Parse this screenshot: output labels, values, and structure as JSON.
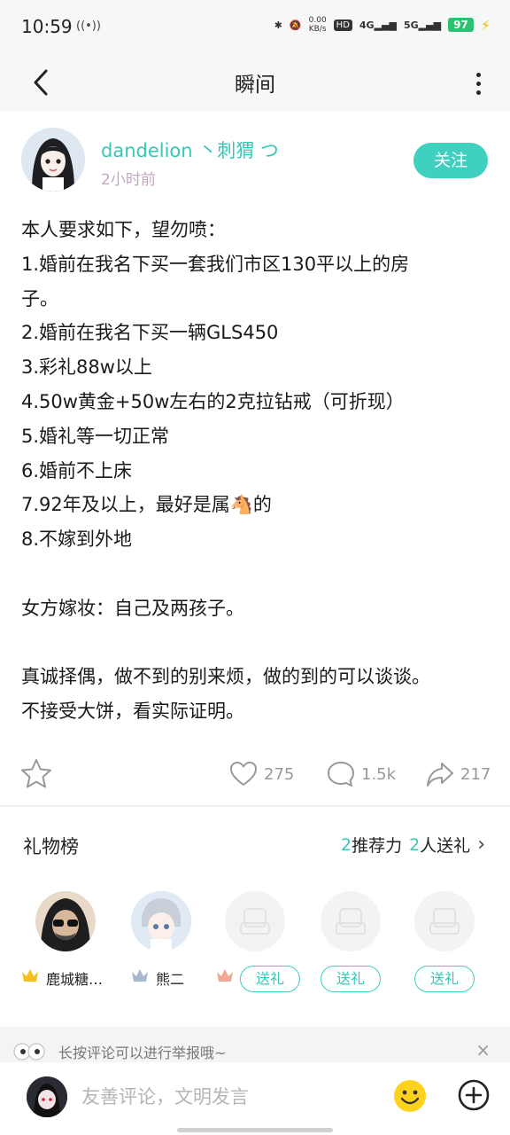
{
  "status_bar": {
    "time": "10:59",
    "hotspot": "((•))",
    "speed_value": "0.00",
    "speed_unit": "KB/s",
    "hd": "HD",
    "signal_1": "4G",
    "signal_2": "5G",
    "battery": "97",
    "icons": [
      "bluetooth-icon",
      "mute-icon",
      "signal-icon",
      "battery-icon",
      "charging-icon"
    ]
  },
  "header": {
    "title": "瞬间",
    "back_icon": "back-arrow-icon",
    "more_icon": "more-vertical-icon"
  },
  "post": {
    "author": "dandelion 丶刺猬 つ",
    "time": "2小时前",
    "follow_label": "关注",
    "lines": [
      "本人要求如下，望勿喷：",
      "1.婚前在我名下买一套我们市区130平以上的房",
      "子。",
      "2.婚前在我名下买一辆GLS450",
      "3.彩礼88w以上",
      "4.50w黄金+50w左右的2克拉钻戒（可折现）",
      "5.婚礼等一切正常",
      "6.婚前不上床",
      "7.92年及以上，最好是属🐴的",
      "8.不嫁到外地",
      "",
      "女方嫁妆：自己及两孩子。",
      "",
      "真诚择偶，做不到的别来烦，做的到的可以谈谈。",
      "不接受大饼，看实际证明。"
    ]
  },
  "actions": {
    "like_count": "275",
    "comment_count": "1.5k",
    "share_count": "217"
  },
  "gifts": {
    "title": "礼物榜",
    "recommend_num": "2",
    "recommend_label": "推荐力",
    "senders_num": "2",
    "senders_label": "人送礼",
    "slots": [
      {
        "name": "鹿城糖…",
        "rank": "1"
      },
      {
        "name": "熊二",
        "rank": "2"
      },
      {
        "rank": "3",
        "button": "送礼"
      },
      {
        "button": "送礼"
      },
      {
        "button": "送礼"
      }
    ]
  },
  "tip": {
    "text": "长按评论可以进行举报哦~",
    "close": "×"
  },
  "comment": {
    "placeholder": "友善评论，文明发言"
  },
  "colors": {
    "accent": "#3fd0c0",
    "text": "#1a1a1a",
    "muted": "#999999"
  }
}
